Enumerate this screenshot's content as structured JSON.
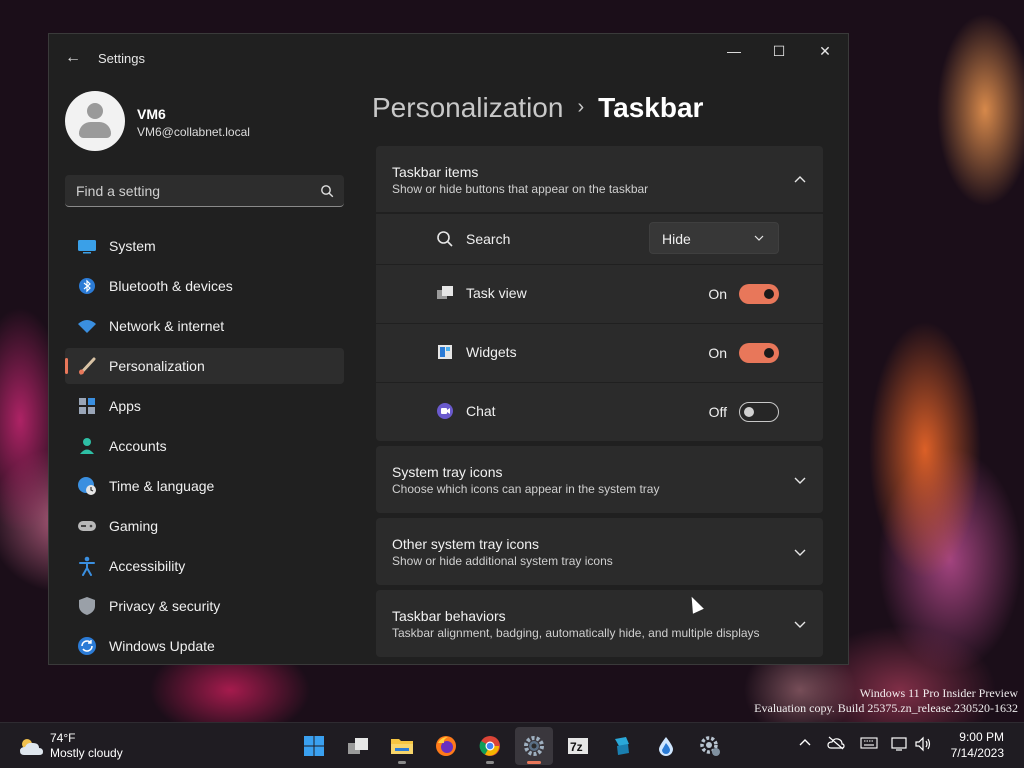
{
  "window": {
    "title": "Settings",
    "minimize": "—",
    "maximize": "☐",
    "close": "✕",
    "back": "←"
  },
  "profile": {
    "name": "VM6",
    "email": "VM6@collabnet.local"
  },
  "search": {
    "placeholder": "Find a setting"
  },
  "nav": [
    {
      "label": "System",
      "icon": "system-icon"
    },
    {
      "label": "Bluetooth & devices",
      "icon": "bluetooth-icon"
    },
    {
      "label": "Network & internet",
      "icon": "wifi-icon"
    },
    {
      "label": "Personalization",
      "icon": "brush-icon",
      "active": true
    },
    {
      "label": "Apps",
      "icon": "apps-icon"
    },
    {
      "label": "Accounts",
      "icon": "accounts-icon"
    },
    {
      "label": "Time & language",
      "icon": "globe-clock-icon"
    },
    {
      "label": "Gaming",
      "icon": "gamepad-icon"
    },
    {
      "label": "Accessibility",
      "icon": "accessibility-icon"
    },
    {
      "label": "Privacy & security",
      "icon": "shield-icon"
    },
    {
      "label": "Windows Update",
      "icon": "update-icon"
    }
  ],
  "breadcrumb": {
    "parent": "Personalization",
    "separator": "›",
    "current": "Taskbar"
  },
  "taskbar_items": {
    "title": "Taskbar items",
    "description": "Show or hide buttons that appear on the taskbar",
    "rows": [
      {
        "label": "Search",
        "control": "dropdown",
        "value": "Hide"
      },
      {
        "label": "Task view",
        "control": "toggle",
        "state": "On",
        "on": true
      },
      {
        "label": "Widgets",
        "control": "toggle",
        "state": "On",
        "on": true
      },
      {
        "label": "Chat",
        "control": "toggle",
        "state": "Off",
        "on": false
      }
    ]
  },
  "sections": [
    {
      "title": "System tray icons",
      "description": "Choose which icons can appear in the system tray"
    },
    {
      "title": "Other system tray icons",
      "description": "Show or hide additional system tray icons"
    },
    {
      "title": "Taskbar behaviors",
      "description": "Taskbar alignment, badging, automatically hide, and multiple displays"
    }
  ],
  "desktop": {
    "watermark_line1": "Windows 11 Pro Insider Preview",
    "watermark_line2": "Evaluation copy. Build 25375.zn_release.230520-1632"
  },
  "weather": {
    "temp": "74°F",
    "condition": "Mostly cloudy"
  },
  "taskbar_apps": [
    "windows-start-icon",
    "task-view-icon",
    "file-explorer-icon",
    "firefox-icon",
    "chrome-icon",
    "settings-icon",
    "7zip-icon",
    "app-icon",
    "drop-icon",
    "gear-app-icon"
  ],
  "clock": {
    "time": "9:00 PM",
    "date": "7/14/2023"
  },
  "colors": {
    "accent": "#e8775a",
    "window_bg": "#202020",
    "card_bg": "#2b2b2b"
  }
}
